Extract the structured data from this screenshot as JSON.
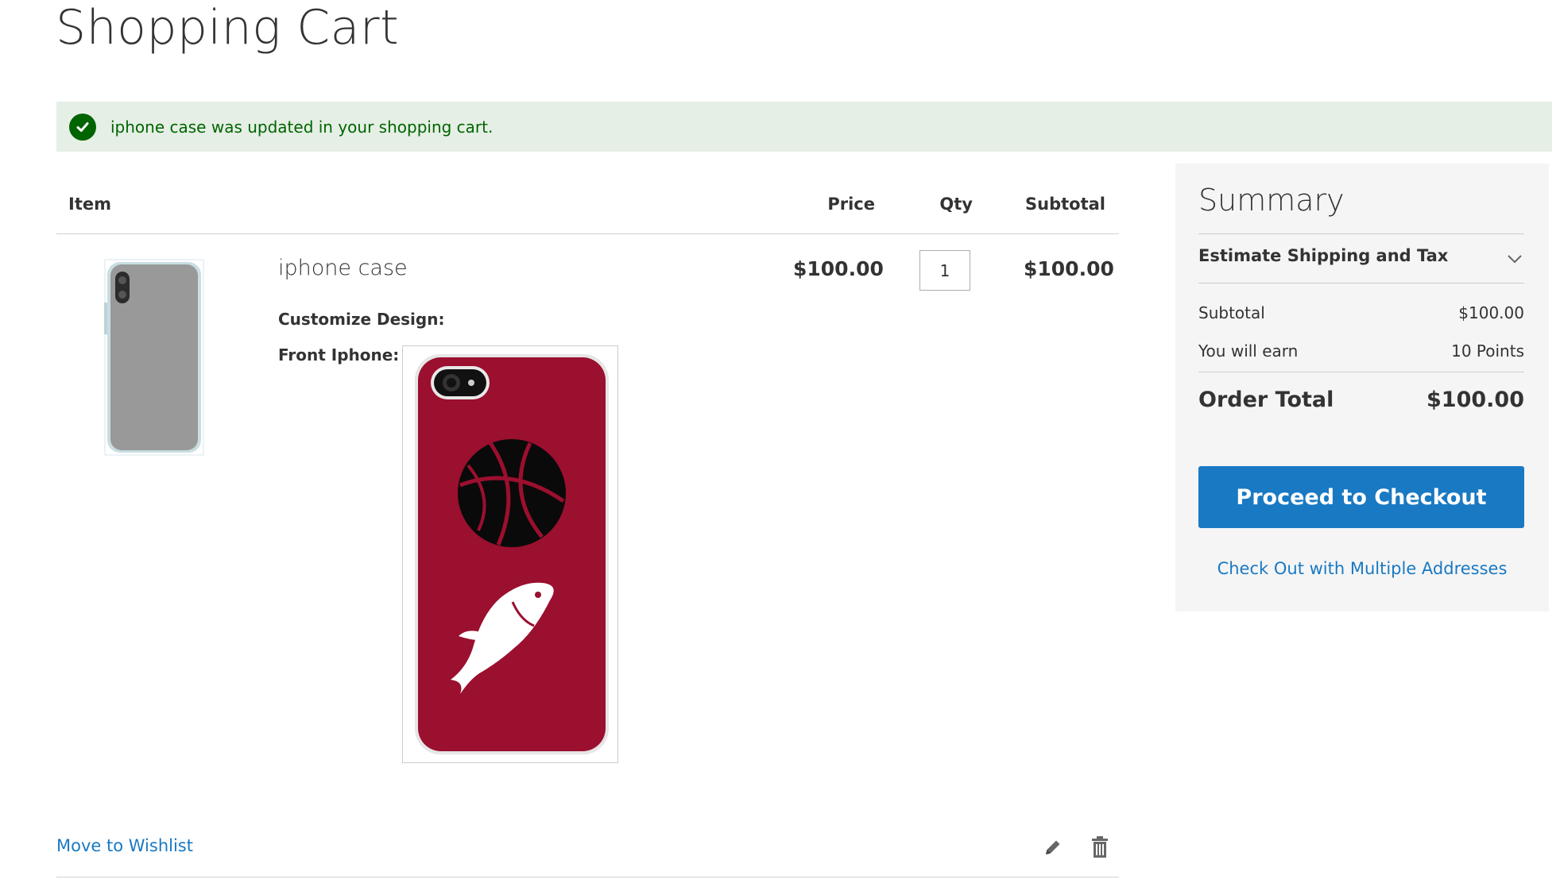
{
  "page": {
    "title": "Shopping Cart"
  },
  "message": {
    "text": "iphone case was updated in your shopping cart.",
    "color": "#006400",
    "background": "#e5efe5"
  },
  "cart": {
    "headers": {
      "item": "Item",
      "price": "Price",
      "qty": "Qty",
      "subtotal": "Subtotal"
    },
    "items": [
      {
        "name": "iphone case",
        "price": "$100.00",
        "qty": "1",
        "subtotal": "$100.00",
        "options": [
          {
            "label": "Customize Design:"
          },
          {
            "label": "Front Iphone:"
          }
        ]
      }
    ],
    "actions": {
      "wishlist": "Move to Wishlist",
      "edit_icon": "pencil-icon",
      "delete_icon": "trash-icon"
    }
  },
  "summary": {
    "title": "Summary",
    "estimate": "Estimate Shipping and Tax",
    "rows": [
      {
        "label": "Subtotal",
        "value": "$100.00"
      },
      {
        "label": "You will earn",
        "value": "10 Points"
      }
    ],
    "order_total": {
      "label": "Order Total",
      "value": "$100.00"
    },
    "checkout_button": "Proceed to Checkout",
    "multi_address_link": "Check Out with Multiple Addresses"
  },
  "colors": {
    "accent": "#1979c3",
    "case_red": "#9b0f2f"
  }
}
